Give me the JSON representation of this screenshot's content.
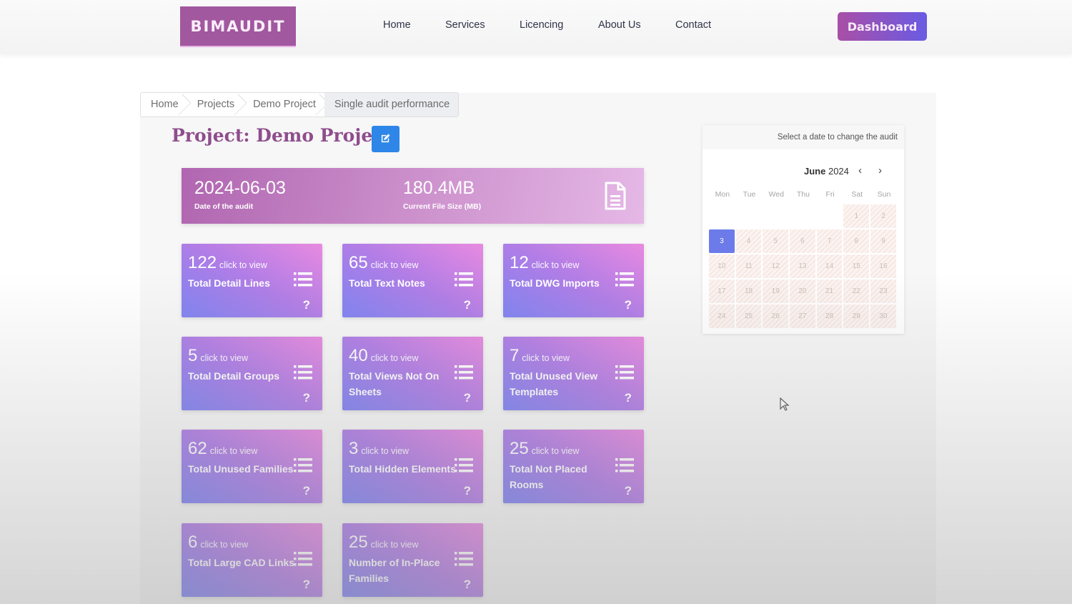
{
  "header": {
    "logo": "BIMAUDIT",
    "nav": [
      "Home",
      "Services",
      "Licencing",
      "About Us",
      "Contact"
    ],
    "dashboard_button": "Dashboard"
  },
  "breadcrumb": [
    "Home",
    "Projects",
    "Demo Project",
    "Single audit performance"
  ],
  "page": {
    "title": "Project: Demo Project",
    "edit_icon": "edit-icon"
  },
  "summary": {
    "audit_date": "2024-06-03",
    "audit_date_label": "Date of the audit",
    "file_size": "180.4MB",
    "file_size_label": "Current File Size (MB)",
    "icon": "document-icon"
  },
  "cards": [
    {
      "value": "122",
      "cta": "click to view",
      "title": "Total Detail Lines"
    },
    {
      "value": "65",
      "cta": "click to view",
      "title": "Total Text Notes"
    },
    {
      "value": "12",
      "cta": "click to view",
      "title": "Total DWG Imports"
    },
    {
      "value": "5",
      "cta": "click to view",
      "title": "Total Detail Groups"
    },
    {
      "value": "40",
      "cta": "click to view",
      "title": "Total Views Not On Sheets"
    },
    {
      "value": "7",
      "cta": "click to view",
      "title": "Total Unused View Templates"
    },
    {
      "value": "62",
      "cta": "click to view",
      "title": "Total Unused Families"
    },
    {
      "value": "3",
      "cta": "click to view",
      "title": "Total Hidden Elements"
    },
    {
      "value": "25",
      "cta": "click to view",
      "title": "Total Not Placed Rooms"
    },
    {
      "value": "6",
      "cta": "click to view",
      "title": "Total Large CAD Links"
    },
    {
      "value": "25",
      "cta": "click to view",
      "title": "Number of In-Place Families"
    }
  ],
  "card_icons": {
    "list": "list-icon",
    "help": "?"
  },
  "calendar": {
    "hint": "Select a date to change the audit",
    "month": "June",
    "year": "2024",
    "prev": "‹",
    "next": "›",
    "weekdays": [
      "Mon",
      "Tue",
      "Wed",
      "Thu",
      "Fri",
      "Sat",
      "Sun"
    ],
    "leading_blanks": 5,
    "days_in_month": 30,
    "selected_day": 3
  },
  "colors": {
    "brand": "#a1589f",
    "title": "#8e4d8d",
    "edit_button": "#2e86e8",
    "selected_day": "#6c7be9"
  }
}
